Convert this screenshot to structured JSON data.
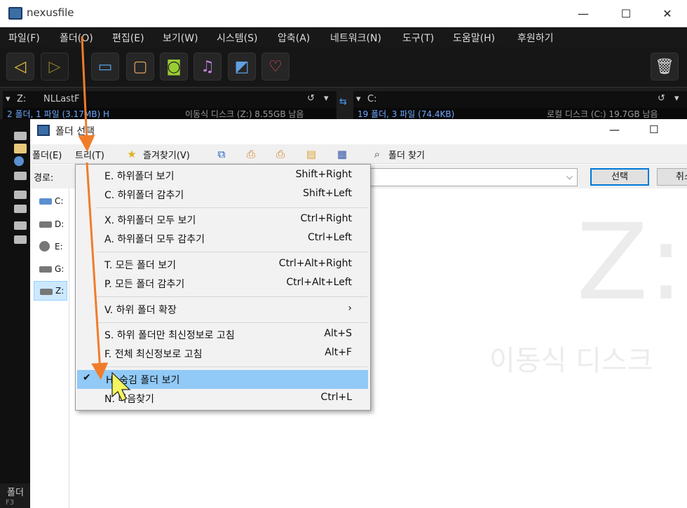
{
  "app": {
    "title": "nexusfile"
  },
  "window_controls": {
    "minimize": "—",
    "maximize": "☐",
    "close": "✕"
  },
  "menubar": [
    "파일(F)",
    "폴더(O)",
    "편집(E)",
    "보기(W)",
    "시스템(S)",
    "압축(A)",
    "네트워크(N)",
    "도구(T)",
    "도움말(H)",
    "후원하기"
  ],
  "left_pane": {
    "path_drive": "Z:",
    "path_folder": "NLLastF",
    "info": "2 폴더, 1 파일 (3.17MB) H",
    "disk_info": "이동식 디스크 (Z:) 8.55GB 남음"
  },
  "right_pane": {
    "path_drive": "C:",
    "info": "19 폴더, 3 파일 (74.4KB)",
    "disk_info": "로컬 디스크 (C:) 19.7GB 남음"
  },
  "bottom_left": {
    "label": "폴더",
    "sub": "F3"
  },
  "dialog": {
    "title": "폴더 선택",
    "menu": [
      "폴더(E)",
      "트리(T)",
      "즐겨찾기(V)",
      "폴더 찾기"
    ],
    "path_label": "경로:",
    "select_button": "선택",
    "cancel_button": "취소",
    "drives": [
      "C:",
      "D:",
      "E:",
      "G:",
      "Z:"
    ],
    "preview_drive": "Z:",
    "preview_label": "이동식 디스크"
  },
  "context_menu": [
    {
      "label": "E. 하위폴더 보기",
      "shortcut": "Shift+Right"
    },
    {
      "label": "C. 하위폴더 감추기",
      "shortcut": "Shift+Left"
    },
    {
      "label": "X. 하위폴더 모두 보기",
      "shortcut": "Ctrl+Right"
    },
    {
      "label": "A. 하위폴더 모두 감추기",
      "shortcut": "Ctrl+Left"
    },
    {
      "label": "T. 모든 폴더 보기",
      "shortcut": "Ctrl+Alt+Right"
    },
    {
      "label": "P. 모든 폴더 감추기",
      "shortcut": "Ctrl+Alt+Left"
    },
    {
      "label": "V. 하위 폴더 확장",
      "shortcut": "›"
    },
    {
      "label": "S. 하위 폴더만 최신정보로 고침",
      "shortcut": "Alt+S"
    },
    {
      "label": "F. 전체 최신정보로 고침",
      "shortcut": "Alt+F"
    },
    {
      "label": "H. 숨김 폴더 보기",
      "shortcut": "",
      "checked": "✔"
    },
    {
      "label": "N. 다음찾기",
      "shortcut": "Ctrl+L"
    }
  ],
  "colors": {
    "accent": "#0078d7",
    "highlight": "#91c9f7",
    "arrow": "#f07c2a",
    "info_blue": "#6fa8ff"
  }
}
